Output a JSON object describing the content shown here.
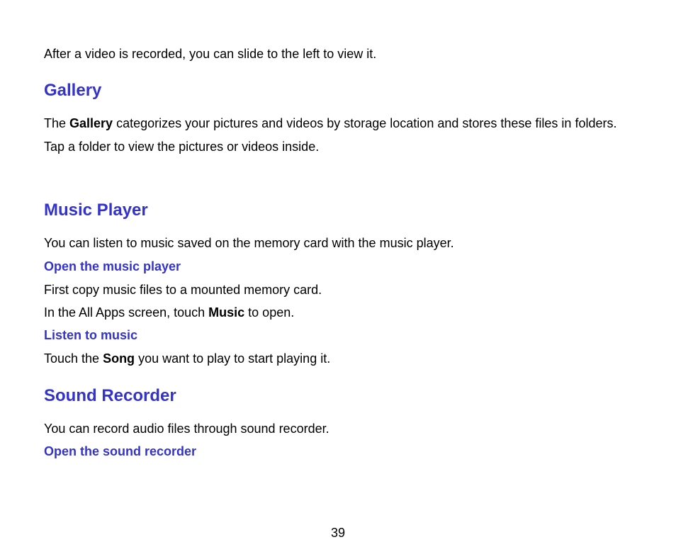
{
  "intro": "After a video is recorded, you can slide to the left to view it.",
  "gallery": {
    "heading": "Gallery",
    "para_pre": "The ",
    "para_bold": "Gallery",
    "para_post": " categorizes your pictures and videos by storage location and stores these files in folders. Tap a folder to view the pictures or videos inside."
  },
  "music": {
    "heading": "Music Player",
    "intro": "You can listen to music saved on the memory card with the music player.",
    "open_heading": "Open the music player",
    "open_line1": "First copy music files to a mounted memory card.",
    "open_line2_pre": "In the All Apps screen, touch ",
    "open_line2_bold": "Music",
    "open_line2_post": " to open.",
    "listen_heading": "Listen to music",
    "listen_line_pre": "Touch the ",
    "listen_line_bold": "Song",
    "listen_line_post": " you want to play to start playing it."
  },
  "sound": {
    "heading": "Sound Recorder",
    "intro": "You can record audio files through sound recorder.",
    "open_heading": "Open the sound recorder"
  },
  "page_number": "39"
}
